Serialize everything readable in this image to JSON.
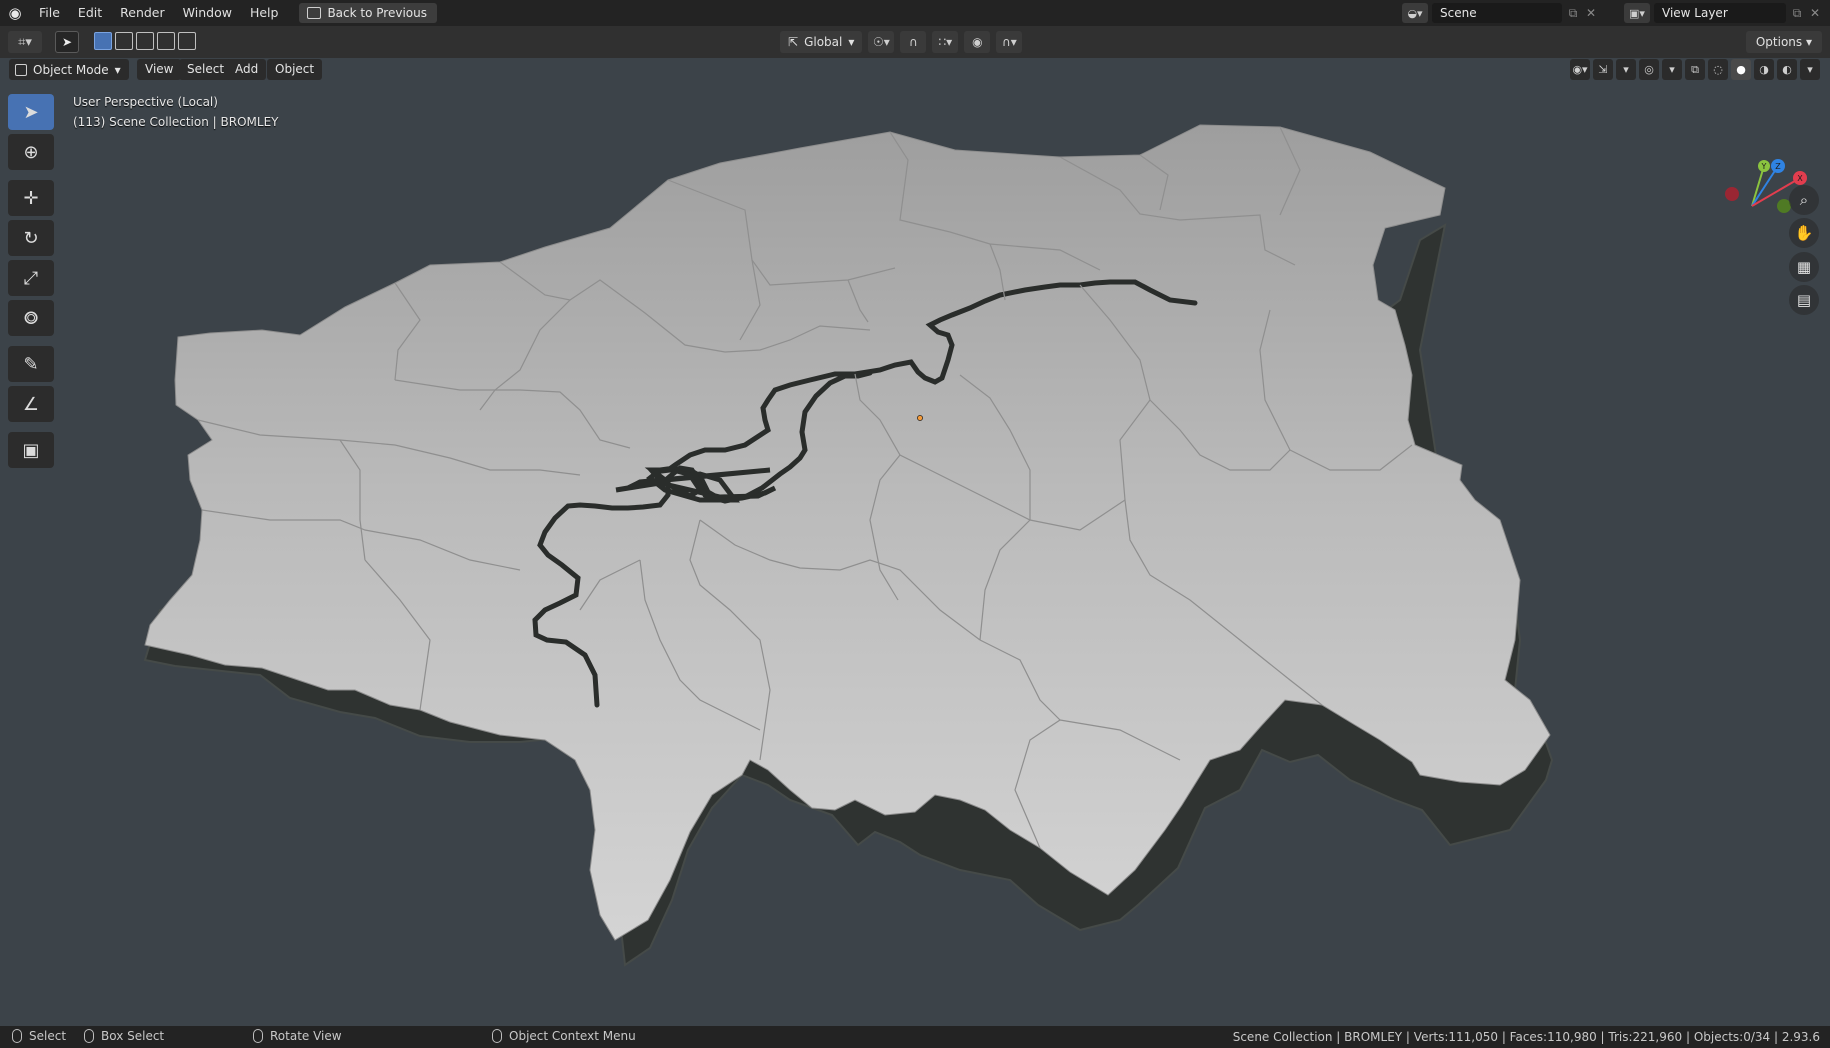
{
  "menubar": {
    "items": [
      "File",
      "Edit",
      "Render",
      "Window",
      "Help"
    ],
    "back_button": "Back to Previous",
    "scene_name": "Scene",
    "view_layer": "View Layer"
  },
  "toolheader": {
    "transform_orientation": "Global",
    "options_label": "Options"
  },
  "viewport_header": {
    "mode": "Object Mode",
    "menus": [
      "View",
      "Select",
      "Add",
      "Object"
    ]
  },
  "viewport": {
    "perspective_label": "User Perspective (Local)",
    "collection_label": "(113) Scene Collection | BROMLEY",
    "background_color": "#3c4349",
    "mesh_color": "#bdbdbd"
  },
  "gizmo": {
    "axes": [
      "X",
      "Y",
      "Z"
    ],
    "colors": {
      "x": "#e23d4e",
      "y": "#8bc43f",
      "z": "#2f83e3"
    }
  },
  "statusbar": {
    "select": "Select",
    "box_select": "Box Select",
    "rotate_view": "Rotate View",
    "context_menu": "Object Context Menu",
    "stats": "Scene Collection | BROMLEY | Verts:111,050 | Faces:110,980 | Tris:221,960 | Objects:0/34 | 2.93.6"
  }
}
